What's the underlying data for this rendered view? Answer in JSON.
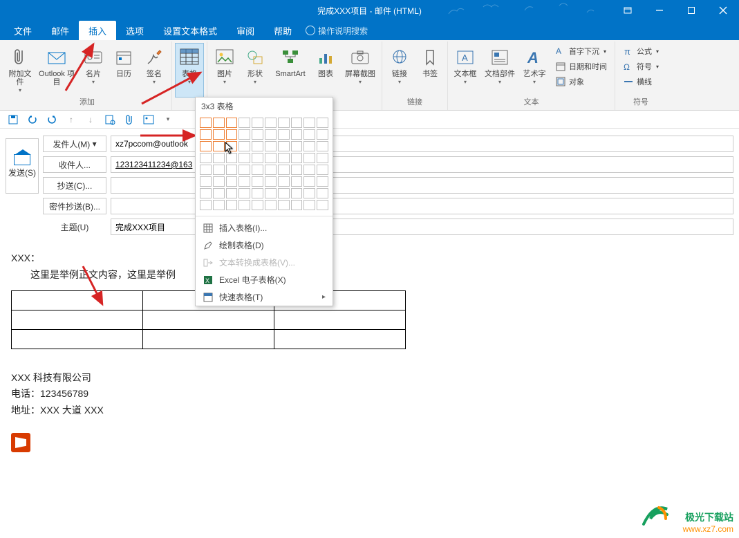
{
  "title": "完成XXX项目 - 邮件 (HTML)",
  "tabs": {
    "file": "文件",
    "mail": "邮件",
    "insert": "插入",
    "options": "选项",
    "format": "设置文本格式",
    "review": "审阅",
    "help": "帮助",
    "tellme": "操作说明搜索"
  },
  "ribbon": {
    "group_add": "添加",
    "group_table": "",
    "group_illus": "",
    "group_link": "链接",
    "group_text": "文本",
    "group_symbol": "符号",
    "attach": "附加文件",
    "outlook_item": "Outlook 项目",
    "biz_card": "名片",
    "calendar": "日历",
    "signature": "签名",
    "table": "表格",
    "picture": "图片",
    "shapes": "形状",
    "smartart": "SmartArt",
    "chart": "图表",
    "screenshot": "屏幕截图",
    "hyperlink": "链接",
    "bookmark": "书签",
    "textbox": "文本框",
    "quickparts": "文档部件",
    "wordart": "艺术字",
    "dropcap": "首字下沉",
    "datetime": "日期和时间",
    "object": "对象",
    "equation": "公式",
    "symbol": "符号",
    "hline": "横线"
  },
  "popup": {
    "head": "3x3 表格",
    "insert_table": "插入表格(I)...",
    "draw_table": "绘制表格(D)",
    "convert": "文本转换成表格(V)...",
    "excel": "Excel 电子表格(X)",
    "quick": "快速表格(T)"
  },
  "addr": {
    "send": "发送(S)",
    "from": "发件人(M)",
    "to": "收件人...",
    "cc": "抄送(C)...",
    "bcc": "密件抄送(B)...",
    "subject": "主题(U)",
    "from_val": "xz7pccom@outlook",
    "to_val": "123123411234@163",
    "subject_val": "完成XXX项目"
  },
  "body": {
    "greet": "XXX：",
    "line": "这里是举例正文内容，这里是举例",
    "sig1": "XXX 科技有限公司",
    "sig2": "电话：123456789",
    "sig3": "地址：XXX 大道 XXX"
  },
  "watermark": {
    "brand": "极光下载站",
    "url": "www.xz7.com"
  }
}
